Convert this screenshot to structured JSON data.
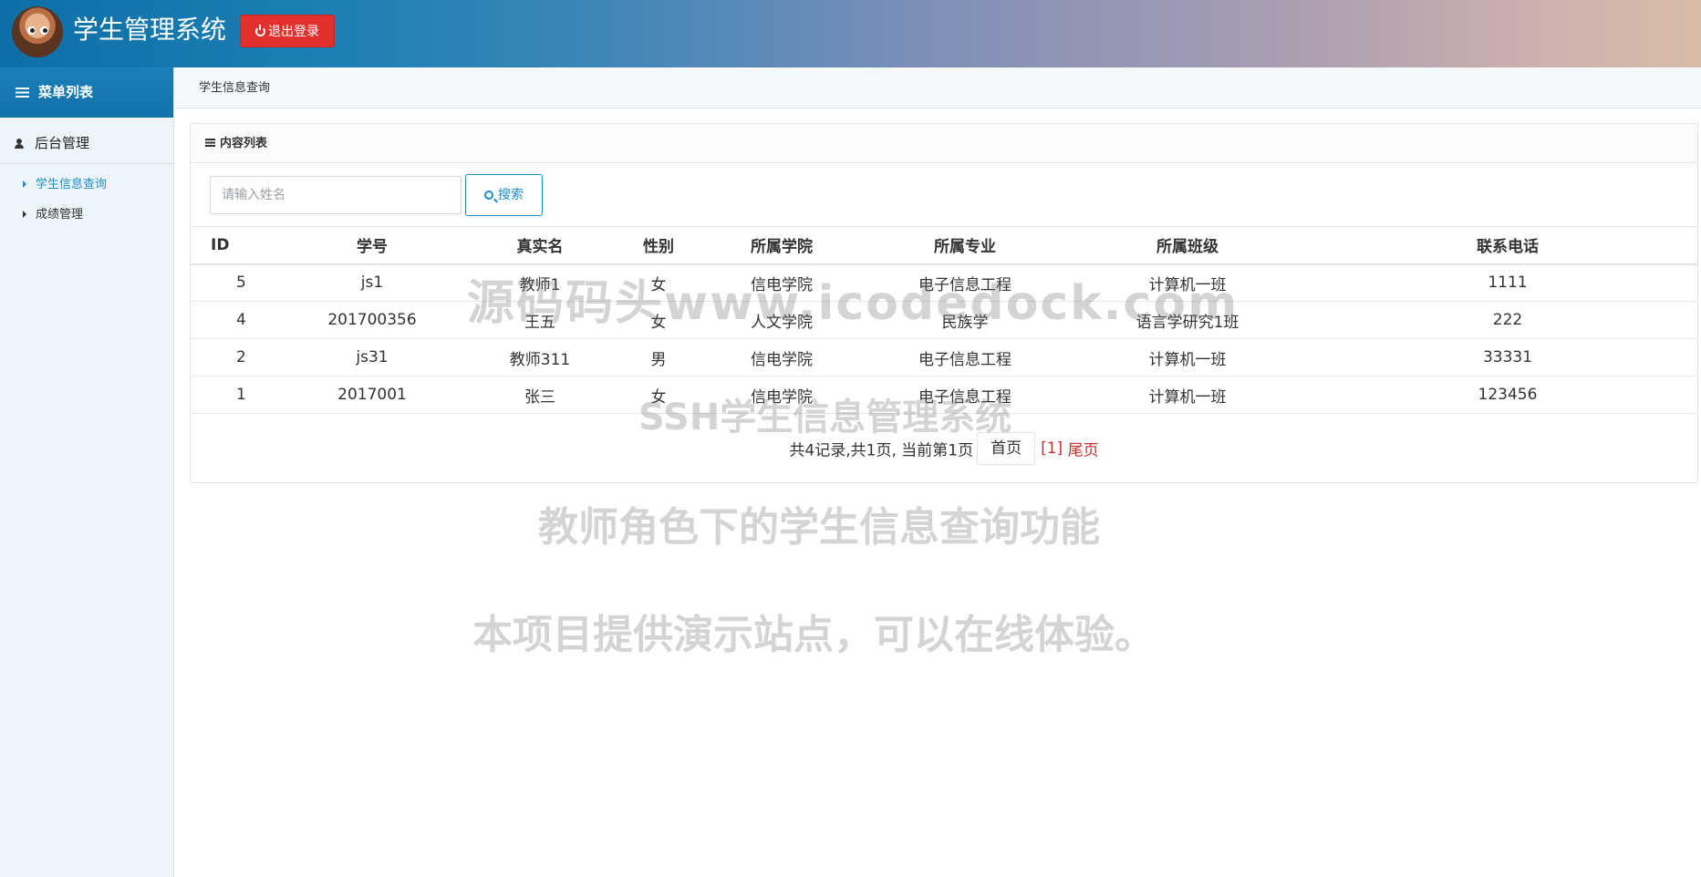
{
  "header": {
    "app_title": "学生管理系统",
    "logout_label": "退出登录",
    "logout_color": "#e3302c"
  },
  "sidebar": {
    "menu_title": "菜单列表",
    "group_title": "后台管理",
    "items": [
      {
        "label": "学生信息查询",
        "active": true
      },
      {
        "label": "成绩管理",
        "active": false
      }
    ],
    "accent_color": "#1a8fc8"
  },
  "breadcrumb": "学生信息查询",
  "panel": {
    "title": "内容列表",
    "search": {
      "placeholder": "请输入姓名",
      "value": "",
      "button_label": "搜索"
    },
    "table": {
      "headers": [
        "ID",
        "学号",
        "真实名",
        "性别",
        "所属学院",
        "所属专业",
        "所属班级",
        "联系电话"
      ],
      "rows": [
        [
          "5",
          "js1",
          "教师1",
          "女",
          "信电学院",
          "电子信息工程",
          "计算机一班",
          "1111"
        ],
        [
          "4",
          "201700356",
          "王五",
          "女",
          "人文学院",
          "民族学",
          "语言学研究1班",
          "222"
        ],
        [
          "2",
          "js31",
          "教师311",
          "男",
          "信电学院",
          "电子信息工程",
          "计算机一班",
          "33331"
        ],
        [
          "1",
          "2017001",
          "张三",
          "女",
          "信电学院",
          "电子信息工程",
          "计算机一班",
          "123456"
        ]
      ]
    },
    "pager": {
      "info": "共4记录,共1页, 当前第1页",
      "first_label": "首页",
      "current": "[1]",
      "last_label": "尾页"
    }
  },
  "watermarks": [
    "源码码头www.icodedock.com",
    "SSH学生信息管理系统",
    "教师角色下的学生信息查询功能",
    "本项目提供演示站点，可以在线体验。"
  ]
}
